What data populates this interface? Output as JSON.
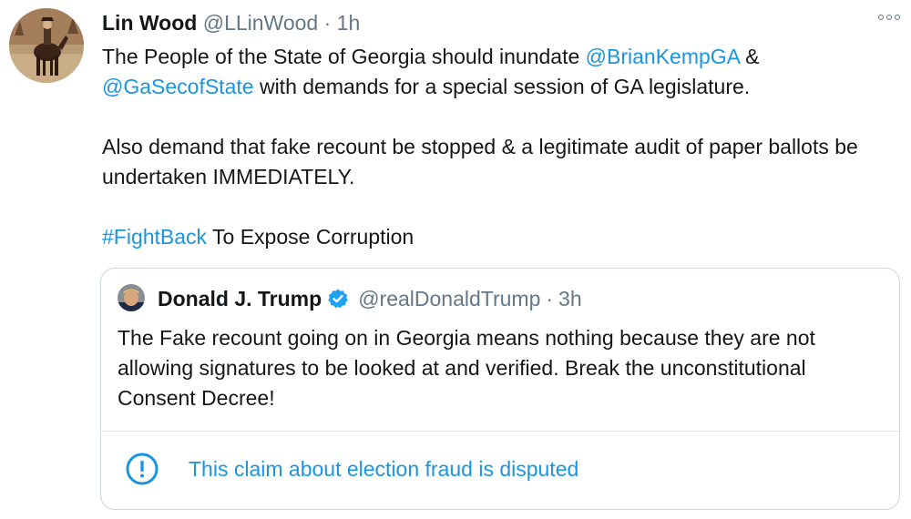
{
  "tweet": {
    "author": {
      "display_name": "Lin Wood",
      "handle": "@LLinWood",
      "separator": "·",
      "time": "1h",
      "avatar_icon": "horse-rider-avatar"
    },
    "more_icon": "more-options-icon",
    "body": {
      "p1_text1": "The People of the State of Georgia should inundate ",
      "p1_mention1": "@BrianKempGA",
      "p1_text2": " & ",
      "p1_mention2": "@GaSecofState",
      "p1_text3": " with demands for a special session of GA legislature.",
      "p2": "Also demand that fake recount be stopped & a legitimate audit of paper ballots be undertaken IMMEDIATELY.",
      "p3_hashtag": "#FightBack",
      "p3_text": " To Expose Corruption"
    }
  },
  "quote": {
    "author": {
      "display_name": "Donald J. Trump",
      "handle": "@realDonaldTrump",
      "separator": "·",
      "time": "3h",
      "verified_icon": "verified-badge-icon"
    },
    "text": "The Fake recount going on in Georgia means nothing because they are not allowing signatures to be looked at and verified. Break the unconstitutional Consent Decree!",
    "notice": {
      "icon": "exclamation-circle-icon",
      "label": "This claim about election fraud is disputed"
    }
  },
  "colors": {
    "link": "#1b95e0",
    "text": "#14171a",
    "muted": "#657786",
    "border": "#ccd6dd"
  }
}
